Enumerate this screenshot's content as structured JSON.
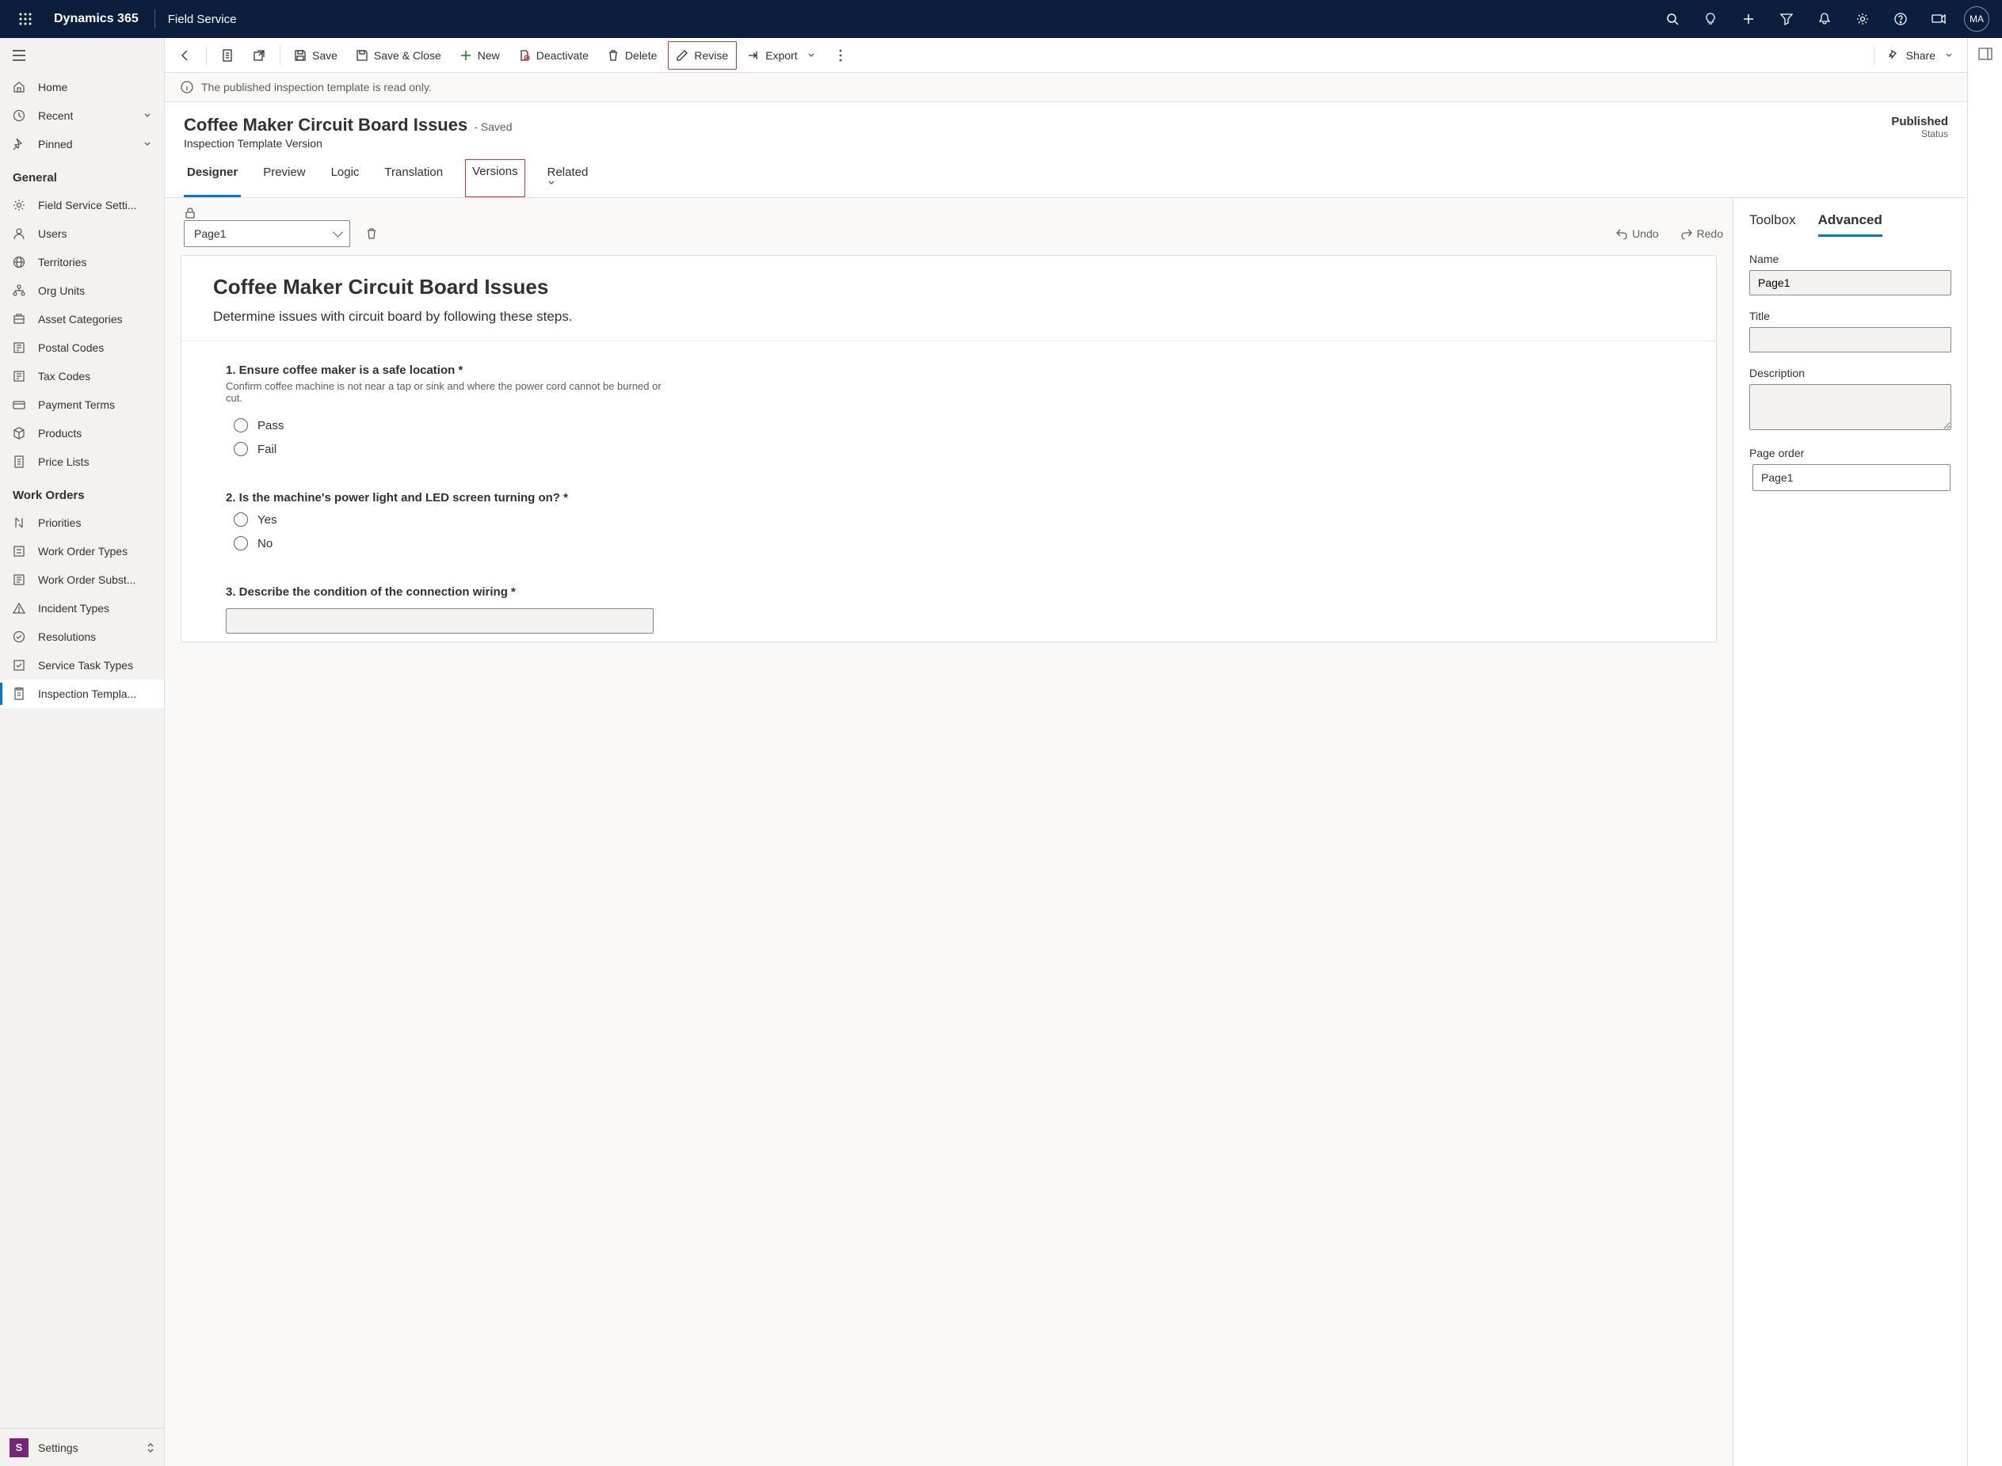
{
  "topbar": {
    "brand": "Dynamics 365",
    "app": "Field Service",
    "avatar": "MA"
  },
  "leftnav": {
    "top": [
      {
        "icon": "home",
        "label": "Home"
      },
      {
        "icon": "clock",
        "label": "Recent",
        "chev": true
      },
      {
        "icon": "pin",
        "label": "Pinned",
        "chev": true
      }
    ],
    "sections": [
      {
        "title": "General",
        "items": [
          {
            "icon": "gear",
            "label": "Field Service Setti..."
          },
          {
            "icon": "person",
            "label": "Users"
          },
          {
            "icon": "globe",
            "label": "Territories"
          },
          {
            "icon": "org",
            "label": "Org Units"
          },
          {
            "icon": "asset",
            "label": "Asset Categories"
          },
          {
            "icon": "postal",
            "label": "Postal Codes"
          },
          {
            "icon": "tax",
            "label": "Tax Codes"
          },
          {
            "icon": "payment",
            "label": "Payment Terms"
          },
          {
            "icon": "product",
            "label": "Products"
          },
          {
            "icon": "price",
            "label": "Price Lists"
          }
        ]
      },
      {
        "title": "Work Orders",
        "items": [
          {
            "icon": "priority",
            "label": "Priorities"
          },
          {
            "icon": "wotype",
            "label": "Work Order Types"
          },
          {
            "icon": "wosub",
            "label": "Work Order Subst..."
          },
          {
            "icon": "incident",
            "label": "Incident Types"
          },
          {
            "icon": "resolution",
            "label": "Resolutions"
          },
          {
            "icon": "servicetask",
            "label": "Service Task Types"
          },
          {
            "icon": "inspection",
            "label": "Inspection Templa...",
            "selected": true
          }
        ]
      }
    ],
    "area": {
      "letter": "S",
      "label": "Settings"
    }
  },
  "cmdbar": {
    "save": "Save",
    "saveclose": "Save & Close",
    "new": "New",
    "deactivate": "Deactivate",
    "delete": "Delete",
    "revise": "Revise",
    "export": "Export",
    "share": "Share"
  },
  "notice": "The published inspection template is read only.",
  "record": {
    "title": "Coffee Maker Circuit Board Issues",
    "saved": "- Saved",
    "subtitle": "Inspection Template Version",
    "status_value": "Published",
    "status_label": "Status"
  },
  "tabs": [
    "Designer",
    "Preview",
    "Logic",
    "Translation",
    "Versions",
    "Related"
  ],
  "active_tab": "Designer",
  "highlighted_tab": "Versions",
  "designer_toolbar": {
    "page": "Page1",
    "undo": "Undo",
    "redo": "Redo"
  },
  "canvas": {
    "title": "Coffee Maker Circuit Board Issues",
    "description": "Determine issues with circuit board by following these steps.",
    "questions": [
      {
        "num": "1.",
        "title": "Ensure coffee maker is a safe location",
        "required": true,
        "help": "Confirm coffee machine is not near a tap or sink and where the power cord cannot be burned or cut.",
        "type": "radio",
        "options": [
          "Pass",
          "Fail"
        ]
      },
      {
        "num": "2.",
        "title": "Is the machine's power light and LED screen turning on?",
        "required": true,
        "type": "radio",
        "options": [
          "Yes",
          "No"
        ]
      },
      {
        "num": "3.",
        "title": "Describe the condition of the connection wiring",
        "required": true,
        "type": "text"
      }
    ]
  },
  "props": {
    "tabs": [
      "Toolbox",
      "Advanced"
    ],
    "active": "Advanced",
    "fields": {
      "name_label": "Name",
      "name_value": "Page1",
      "title_label": "Title",
      "title_value": "",
      "desc_label": "Description",
      "desc_value": "",
      "order_label": "Page order",
      "order_value": "Page1"
    }
  }
}
